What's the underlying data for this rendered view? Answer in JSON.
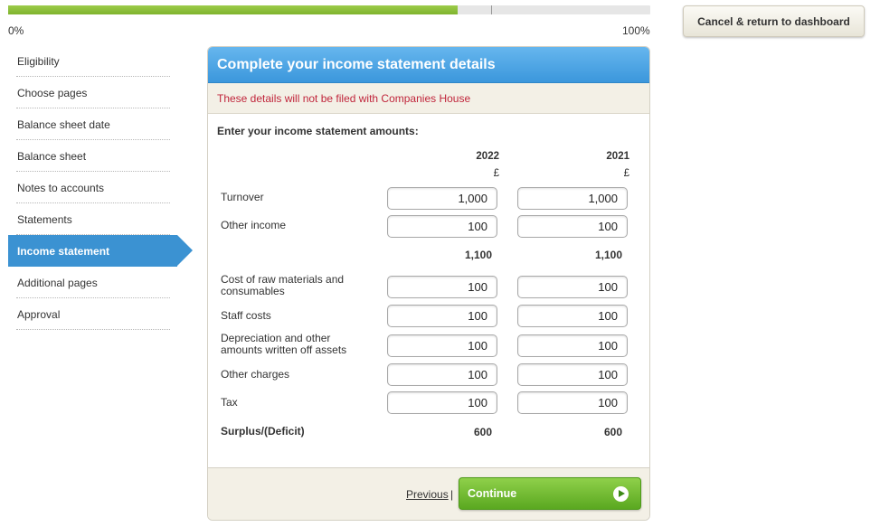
{
  "progress": {
    "percent": 70,
    "start_label": "0%",
    "end_label": "100%"
  },
  "cancel_button": "Cancel & return to dashboard",
  "sidebar": {
    "items": [
      {
        "label": "Eligibility",
        "active": false
      },
      {
        "label": "Choose pages",
        "active": false
      },
      {
        "label": "Balance sheet date",
        "active": false
      },
      {
        "label": "Balance sheet",
        "active": false
      },
      {
        "label": "Notes to accounts",
        "active": false
      },
      {
        "label": "Statements",
        "active": false
      },
      {
        "label": "Income statement",
        "active": true
      },
      {
        "label": "Additional pages",
        "active": false
      },
      {
        "label": "Approval",
        "active": false
      }
    ]
  },
  "panel": {
    "title": "Complete your income statement details",
    "notice": "These details will not be filed with Companies House",
    "intro": "Enter your income statement amounts:",
    "columns": [
      {
        "year": "2022",
        "currency": "£"
      },
      {
        "year": "2021",
        "currency": "£"
      }
    ],
    "rows": {
      "turnover": {
        "label": "Turnover",
        "values": [
          "1,000",
          "1,000"
        ]
      },
      "other_income": {
        "label": "Other income",
        "values": [
          "100",
          "100"
        ]
      },
      "subtotal": {
        "values": [
          "1,100",
          "1,100"
        ]
      },
      "raw_materials": {
        "label": "Cost of raw materials and consumables",
        "values": [
          "100",
          "100"
        ]
      },
      "staff_costs": {
        "label": "Staff costs",
        "values": [
          "100",
          "100"
        ]
      },
      "depreciation": {
        "label": "Depreciation and other amounts written off assets",
        "values": [
          "100",
          "100"
        ]
      },
      "other_charges": {
        "label": "Other charges",
        "values": [
          "100",
          "100"
        ]
      },
      "tax": {
        "label": "Tax",
        "values": [
          "100",
          "100"
        ]
      },
      "surplus": {
        "label": "Surplus/(Deficit)",
        "values": [
          "600",
          "600"
        ]
      }
    },
    "footer": {
      "previous": "Previous",
      "separator": "|",
      "continue": "Continue"
    }
  },
  "colors": {
    "accent_blue": "#3b92d2",
    "progress_green": "#8cc63f",
    "continue_green": "#6ab82e",
    "notice_red": "#c0253b"
  }
}
